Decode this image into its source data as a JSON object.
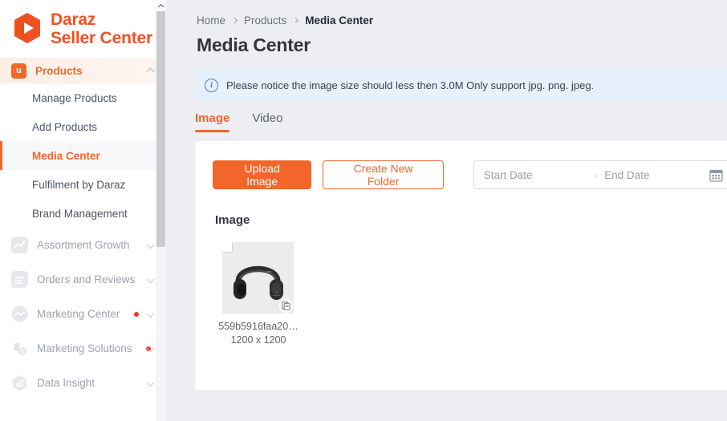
{
  "brand": {
    "line1": "Daraz",
    "line2": "Seller Center",
    "logo_icon": "daraz-logo-icon",
    "color": "#f05123"
  },
  "sidebar": {
    "group": {
      "label": "Products",
      "icon": "products-bag-icon",
      "expanded_chevron": "chevron-up-icon"
    },
    "subitems": [
      {
        "label": "Manage Products",
        "active": false
      },
      {
        "label": "Add Products",
        "active": false
      },
      {
        "label": "Media Center",
        "active": true
      },
      {
        "label": "Fulfilment by Daraz",
        "active": false
      },
      {
        "label": "Brand Management",
        "active": false
      }
    ],
    "items": [
      {
        "label": "Assortment Growth",
        "icon": "trend-up-icon",
        "badge": false
      },
      {
        "label": "Orders and Reviews",
        "icon": "list-lines-icon",
        "badge": false
      },
      {
        "label": "Marketing Center",
        "icon": "wave-circle-icon",
        "badge": true
      },
      {
        "label": "Marketing Solutions",
        "icon": "megaphone-coin-icon",
        "badge": true
      },
      {
        "label": "Data Insight",
        "icon": "bar-chart-icon",
        "badge": false
      }
    ],
    "scrollbar": {
      "up_icon": "chevron-up-icon"
    }
  },
  "breadcrumb": {
    "items": [
      "Home",
      "Products",
      "Media Center"
    ],
    "separator_icon": "chevron-right-icon"
  },
  "page": {
    "title": "Media Center"
  },
  "notice": {
    "icon": "info-circle-icon",
    "text": "Please notice the image size should less then 3.0M Only support jpg. png. jpeg.",
    "bg_color": "#e7f0fd"
  },
  "tabs": [
    {
      "label": "Image",
      "active": true
    },
    {
      "label": "Video",
      "active": false
    }
  ],
  "toolbar": {
    "upload_label": "Upload Image",
    "create_folder_label": "Create New Folder",
    "date_range": {
      "start_placeholder": "Start Date",
      "start_value": "",
      "end_placeholder": "End Date",
      "end_value": "",
      "separator": "-",
      "calendar_icon": "calendar-icon"
    },
    "accent_color": "#f2662a"
  },
  "content": {
    "section_title": "Image",
    "files": [
      {
        "name": "559b5916faa20…",
        "dimensions": "1200 x 1200",
        "thumbnail_alt": "black-headphones-thumbnail",
        "checkbox_checked": false,
        "badge_icon": "document-copy-icon"
      }
    ]
  }
}
